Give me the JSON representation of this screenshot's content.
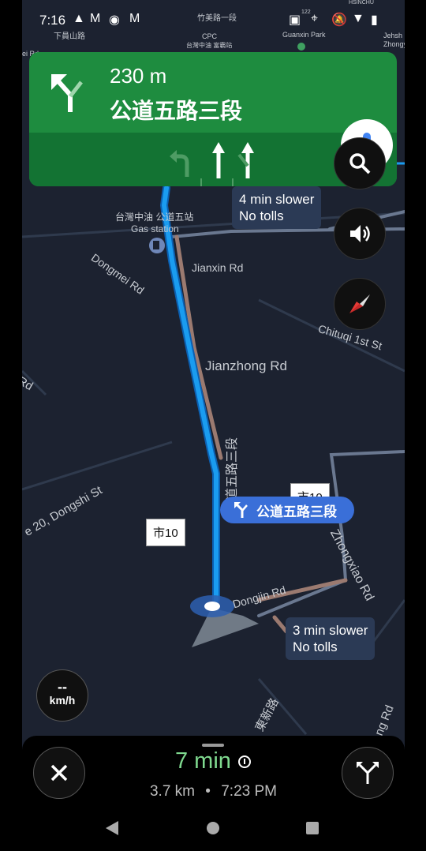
{
  "status_bar": {
    "time": "7:16"
  },
  "map_top_labels": {
    "road1": "竹美路一段",
    "place1": "下員山路",
    "cpc": "CPC",
    "station_small": "台灣中油 富霸站",
    "guanxin": "Guanxin Park",
    "jehsh": "Jehsh",
    "zhongy": "Zhongy",
    "edge_rd": "ei Rd",
    "hsinchu": "HSINCHU",
    "shield122": "122"
  },
  "guidance": {
    "distance": "230 m",
    "street": "公道五路三段"
  },
  "callouts": {
    "top": {
      "line1": "4 min slower",
      "line2": "No tolls"
    },
    "bottom": {
      "line1": "3 min slower",
      "line2": "No tolls"
    }
  },
  "map_labels": {
    "gas_name": "台灣中油 公道五站",
    "gas_type": "Gas station",
    "dongmei": "Dongmei Rd",
    "jianxin": "Jianxin Rd",
    "chituqi": "Chituqi 1st St",
    "jianzhong": "Jianzhong Rd",
    "rd_left": "Rd",
    "dongshi": "e 20, Dongshi St",
    "zhongxiao": "Zhongxiao Rd",
    "dongjin": "Dongjin Rd",
    "route_vertical": "公道五路三段",
    "dongxin": "東新路",
    "rd_right": "ng Rd"
  },
  "route_badges": {
    "a": "市10",
    "b": "市10"
  },
  "next_turn": {
    "street": "公道五路三段"
  },
  "speed": {
    "value": "--",
    "unit": "km/h"
  },
  "trip": {
    "duration": "7 min",
    "distance": "3.7 km",
    "separator": "•",
    "arrival": "7:23 PM"
  },
  "colors": {
    "guidance_green": "#1e8c3f",
    "lane_green": "#137333",
    "route_blue": "#1a9cf0",
    "eta_green": "#7fd98f",
    "map_bg": "#1c2230"
  },
  "icons": {
    "mic": "mic-icon",
    "search": "search-icon",
    "volume": "volume-icon",
    "compass": "compass-icon",
    "close": "close-icon",
    "routes": "alt-routes-icon"
  }
}
